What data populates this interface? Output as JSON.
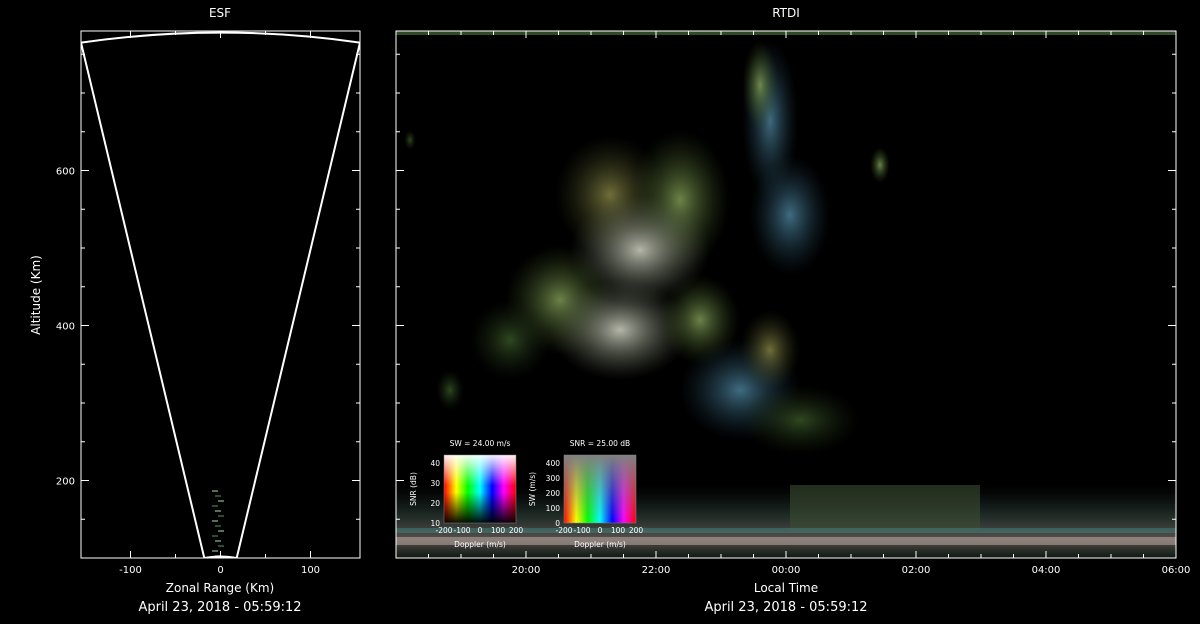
{
  "colors": {
    "background": "#000000",
    "frame": "#ffffff"
  },
  "left": {
    "title": "ESF",
    "xlabel": "Zonal Range (Km)",
    "ylabel": "Altitude (Km)",
    "date": "April 23, 2018 - 05:59:12"
  },
  "right": {
    "title": "RTDI",
    "xlabel": "Local Time",
    "date": "April 23, 2018 - 05:59:12"
  },
  "legend1": {
    "title": "SW = 24.00 m/s",
    "xlabel": "Doppler (m/s)",
    "ylabel": "SNR (dB)",
    "xticks": [
      "-200",
      "-100",
      "0",
      "100",
      "200"
    ],
    "yticks": [
      "40",
      "30",
      "20",
      "10"
    ]
  },
  "legend2": {
    "title": "SNR = 25.00 dB",
    "xlabel": "Doppler (m/s)",
    "ylabel": "SW (m/s)",
    "xticks": [
      "-200",
      "-100",
      "0",
      "100",
      "200"
    ],
    "yticks": [
      "400",
      "300",
      "200",
      "100",
      "0"
    ]
  },
  "chart_data": [
    {
      "type": "scatter",
      "title": "ESF",
      "xlabel": "Zonal Range (Km)",
      "ylabel": "Altitude (Km)",
      "xlim": [
        -155,
        155
      ],
      "ylim": [
        100,
        780
      ],
      "xticks": [
        "-100",
        "0",
        "100"
      ],
      "yticks": [
        "200",
        "400",
        "600"
      ],
      "beam_edges": [
        {
          "x": -18,
          "y": 100
        },
        {
          "x": -155,
          "y": 765
        },
        {
          "x": 18,
          "y": 100
        },
        {
          "x": 155,
          "y": 765
        }
      ],
      "grid": false
    },
    {
      "type": "heatmap",
      "title": "RTDI",
      "xlabel": "Local Time",
      "xlim": [
        "18:00",
        "06:00"
      ],
      "ylim": [
        100,
        780
      ],
      "xticks": [
        "20:00",
        "22:00",
        "00:00",
        "02:00",
        "04:00",
        "06:00"
      ],
      "grid": false
    }
  ]
}
